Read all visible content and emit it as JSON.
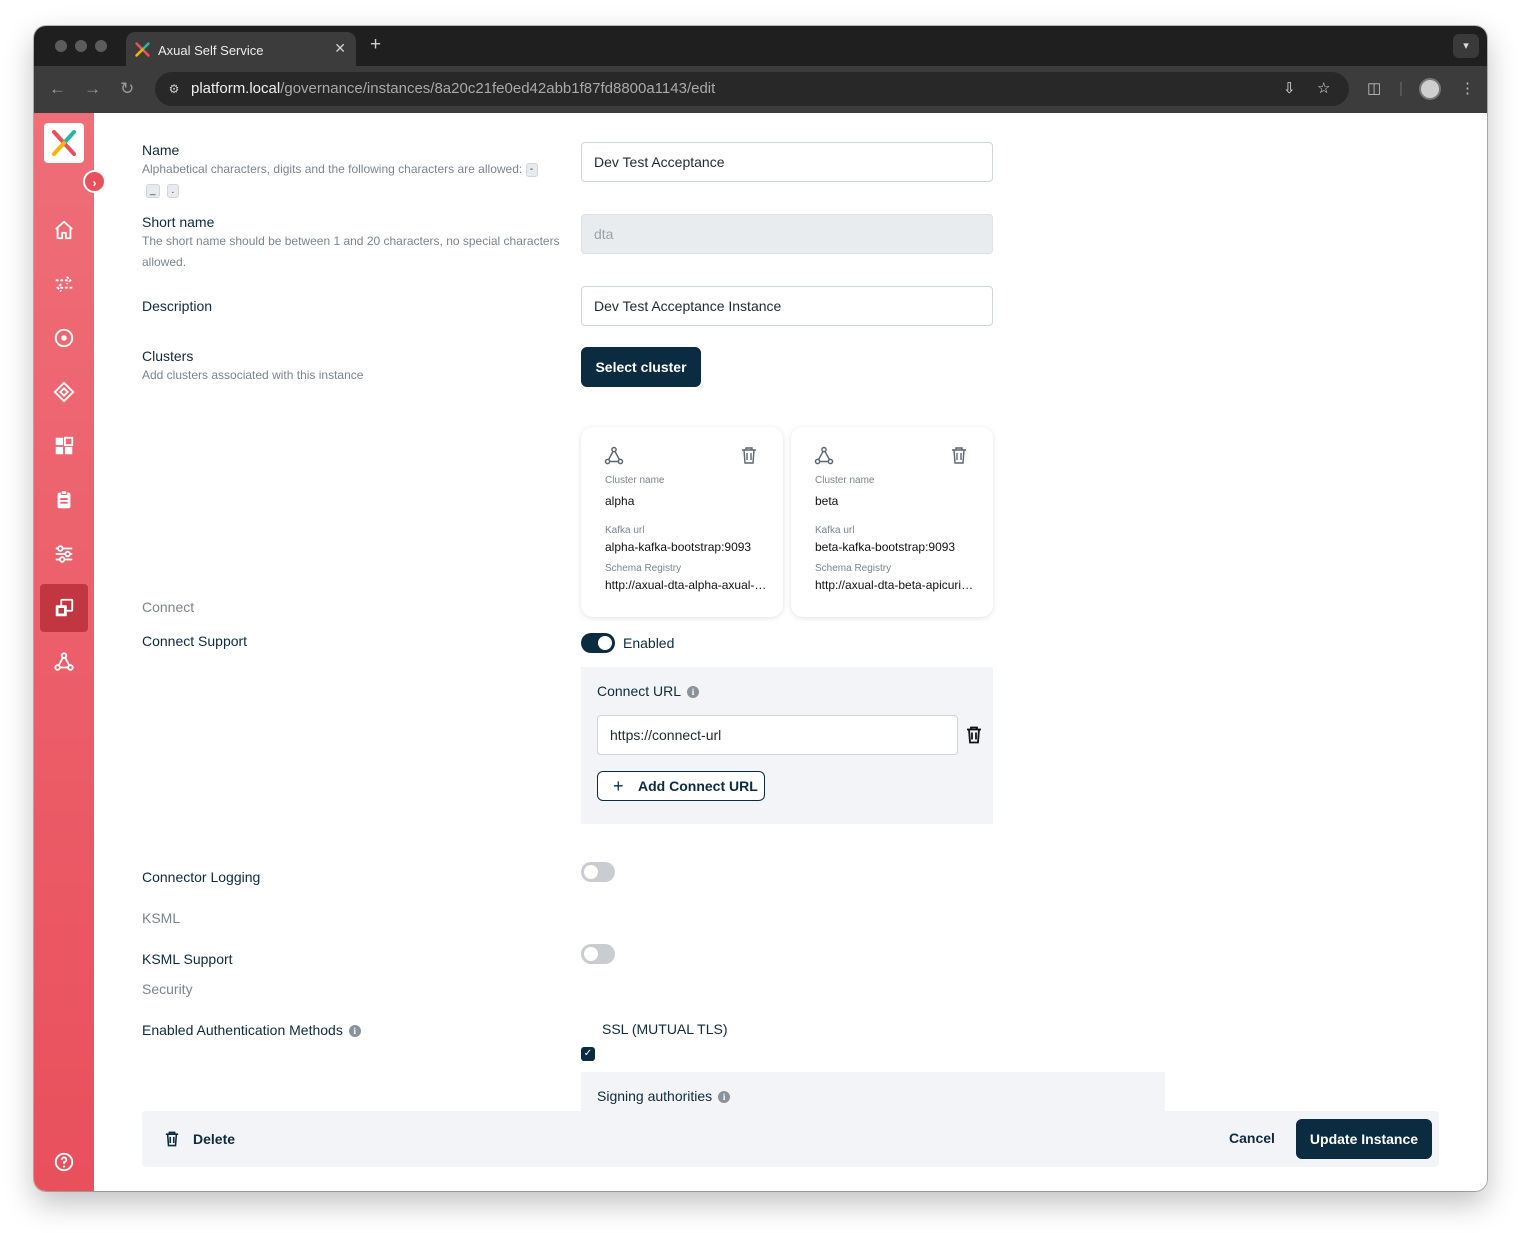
{
  "browser": {
    "tab_title": "Axual Self Service",
    "tab_close": "✕",
    "new_tab": "+",
    "url_host": "platform.local",
    "url_path": "/governance/instances/8a20c21fe0ed42abb1f87fd8800a1143/edit"
  },
  "sidebar": {
    "items": [
      "home",
      "streams",
      "applications",
      "schemas",
      "dashboards",
      "reports",
      "settings",
      "instances",
      "clusters"
    ],
    "active": "instances",
    "help": "help"
  },
  "form": {
    "name": {
      "label": "Name",
      "hint": "Alphabetical characters, digits and the following characters are allowed:",
      "allowed_chars": [
        "-",
        "_",
        "."
      ],
      "value": "Dev Test Acceptance"
    },
    "short_name": {
      "label": "Short name",
      "hint": "The short name should be between 1 and 20 characters, no special characters allowed.",
      "value": "dta"
    },
    "description": {
      "label": "Description",
      "value": "Dev Test Acceptance Instance"
    },
    "clusters": {
      "label": "Clusters",
      "hint": "Add clusters associated with this instance",
      "select_button": "Select cluster",
      "cluster_name_label": "Cluster name",
      "kafka_url_label": "Kafka url",
      "schema_registry_label": "Schema Registry",
      "cards": [
        {
          "name": "alpha",
          "kafka_url": "alpha-kafka-bootstrap:9093",
          "schema_registry": "http://axual-dta-alpha-axual-schema-registry"
        },
        {
          "name": "beta",
          "kafka_url": "beta-kafka-bootstrap:9093",
          "schema_registry": "http://axual-dta-beta-apicurio-registry"
        }
      ]
    },
    "connect": {
      "section": "Connect",
      "support_label": "Connect Support",
      "support_enabled": true,
      "support_state_text": "Enabled",
      "url_label": "Connect URL",
      "urls": [
        "https://connect-url"
      ],
      "add_button": "Add Connect URL",
      "logging_label": "Connector Logging",
      "logging_enabled": false
    },
    "ksml": {
      "section": "KSML",
      "support_label": "KSML Support",
      "support_enabled": false
    },
    "security": {
      "section": "Security",
      "auth_label": "Enabled Authentication Methods",
      "ssl_label": "SSL (MUTUAL TLS)",
      "ssl_checked": true,
      "signing_label": "Signing authorities"
    }
  },
  "footer": {
    "delete": "Delete",
    "cancel": "Cancel",
    "update": "Update Instance"
  },
  "colors": {
    "primary": "#0b2b40",
    "sidebar_top": "#ef6e78",
    "sidebar_bottom": "#e8505c",
    "sidebar_active": "#c23641"
  }
}
